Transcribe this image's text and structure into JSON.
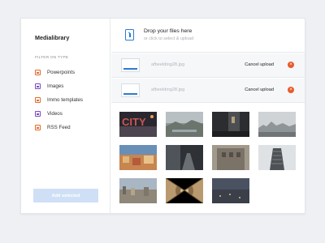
{
  "sidebar": {
    "title": "Medialibrary",
    "filter_label": "FILTER ON TYPE",
    "items": [
      {
        "label": "Powerpoints",
        "color": "#e4692e"
      },
      {
        "label": "Images",
        "color": "#7a4bc2"
      },
      {
        "label": "Immo templates",
        "color": "#e4692e"
      },
      {
        "label": "Videos",
        "color": "#7a4bc2"
      },
      {
        "label": "RSS Feed",
        "color": "#e4692e"
      }
    ],
    "add_button": "Add selected"
  },
  "dropzone": {
    "title": "Drop your files here",
    "subtitle": "or click to select & upload"
  },
  "uploads": [
    {
      "filename": "afbeelding28.jpg",
      "action": "Cancel upload",
      "progress": 0.85
    },
    {
      "filename": "afbeelding28.jpg",
      "action": "Cancel upload",
      "progress": 0.85
    }
  ],
  "gallery": {
    "images": [
      {
        "name": "city-sign-photo"
      },
      {
        "name": "harbor-view-photo"
      },
      {
        "name": "street-night-photo"
      },
      {
        "name": "foggy-skyline-photo"
      },
      {
        "name": "colorful-town-photo"
      },
      {
        "name": "dark-road-photo"
      },
      {
        "name": "building-facade-photo"
      },
      {
        "name": "flatiron-building-photo"
      },
      {
        "name": "coastal-city-photo"
      },
      {
        "name": "ornate-ceiling-photo"
      },
      {
        "name": "city-at-dusk-photo"
      }
    ]
  }
}
